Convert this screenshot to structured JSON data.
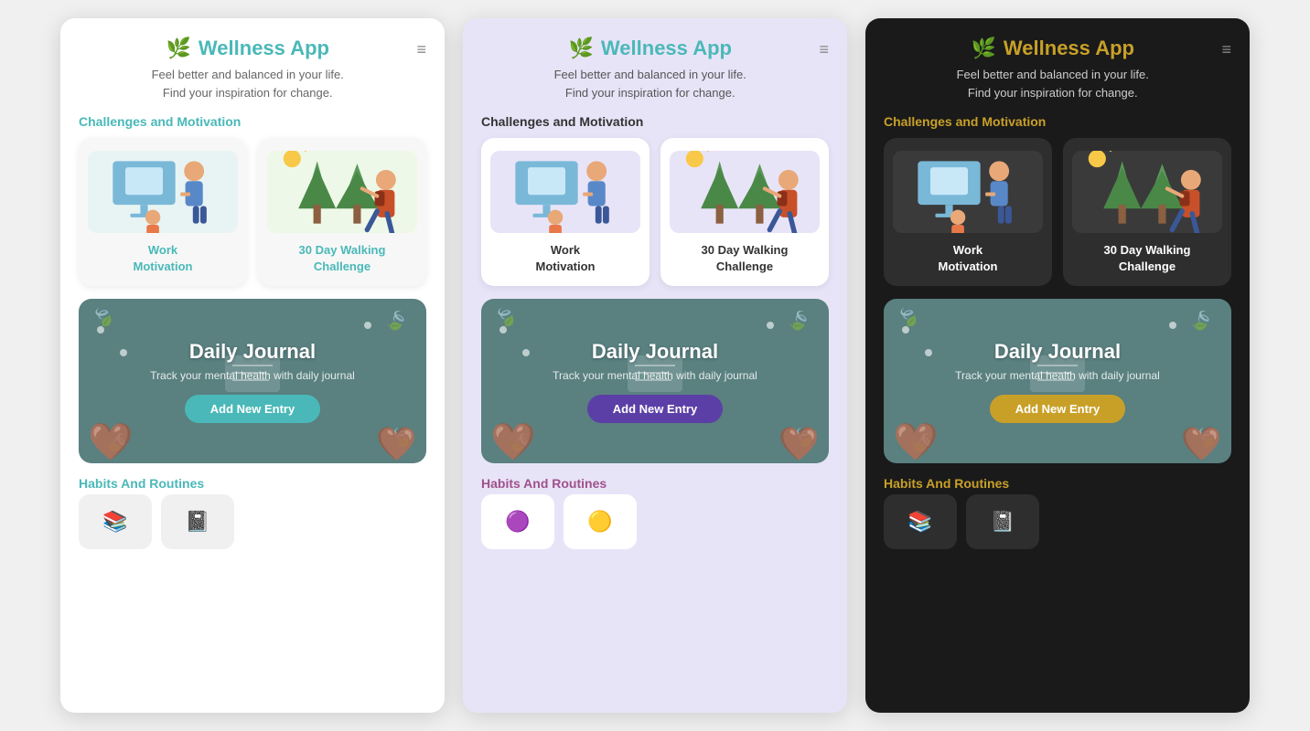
{
  "themes": [
    {
      "id": "light",
      "themeClass": "theme-light",
      "logo": "🌿",
      "appTitle": "Wellness App",
      "subtitle1": "Feel better and balanced in your life.",
      "subtitle2": "Find your inspiration for change.",
      "menuIcon": "≡",
      "sectionTitle": "Challenges and Motivation",
      "cards": [
        {
          "label": "Work\nMotivation",
          "type": "work"
        },
        {
          "label": "30 Day Walking\nChallenge",
          "type": "walk"
        }
      ],
      "journal": {
        "title": "Daily Journal",
        "subtitle": "Track your mental health with daily journal",
        "btnLabel": "Add New Entry"
      },
      "habitsTitle": "Habits And Routines"
    },
    {
      "id": "lavender",
      "themeClass": "theme-lavender",
      "logo": "🌿",
      "appTitle": "Wellness App",
      "subtitle1": "Feel better and balanced in your life.",
      "subtitle2": "Find your inspiration for change.",
      "menuIcon": "≡",
      "sectionTitle": "Challenges and Motivation",
      "cards": [
        {
          "label": "Work\nMotivation",
          "type": "work"
        },
        {
          "label": "30 Day Walking\nChallenge",
          "type": "walk"
        }
      ],
      "journal": {
        "title": "Daily Journal",
        "subtitle": "Track your mental health with daily journal",
        "btnLabel": "Add New Entry"
      },
      "habitsTitle": "Habits And Routines"
    },
    {
      "id": "dark",
      "themeClass": "theme-dark",
      "logo": "🌿",
      "appTitle": "Wellness App",
      "subtitle1": "Feel better and balanced in your life.",
      "subtitle2": "Find your inspiration for change.",
      "menuIcon": "≡",
      "sectionTitle": "Challenges and Motivation",
      "cards": [
        {
          "label": "Work\nMotivation",
          "type": "work"
        },
        {
          "label": "30 Day Walking\nChallenge",
          "type": "walk"
        }
      ],
      "journal": {
        "title": "Daily Journal",
        "subtitle": "Track your mental health with daily journal",
        "btnLabel": "Add New Entry"
      },
      "habitsTitle": "Habits And Routines"
    }
  ]
}
